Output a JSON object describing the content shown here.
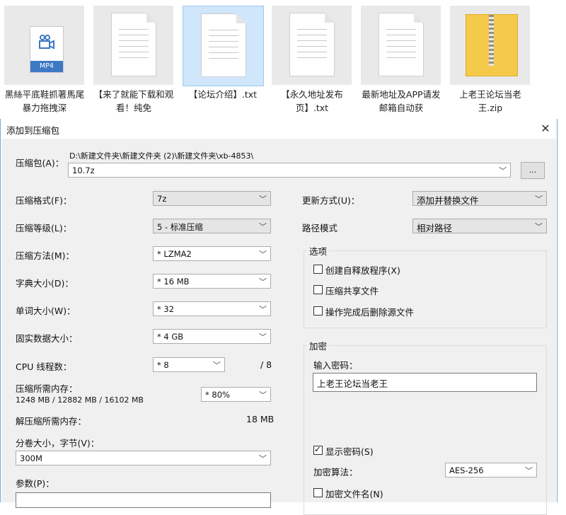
{
  "files": [
    {
      "name": "黑絲平底鞋抓著馬尾暴力拖拽深",
      "type": "MP4",
      "selected": false
    },
    {
      "name": "【来了就能下载和观看！纯免",
      "type": "txt",
      "selected": false
    },
    {
      "name": "【论坛介绍】.txt",
      "type": "txt",
      "selected": true
    },
    {
      "name": "【永久地址发布页】.txt",
      "type": "txt",
      "selected": false
    },
    {
      "name": "最新地址及APP请发邮箱自动获",
      "type": "txt",
      "selected": false
    },
    {
      "name": "上老王论坛当老王.zip",
      "type": "zip",
      "selected": false
    }
  ],
  "mp4_badge": "MP4",
  "dialog": {
    "title": "添加到压缩包",
    "close": "✕",
    "archive_label": "压缩包(A)：",
    "archive_path": "D:\\新建文件夹\\新建文件夹 (2)\\新建文件夹\\xb-4853\\",
    "archive_name": "10.7z",
    "browse": "...",
    "format_label": "压缩格式(F)：",
    "format": "7z",
    "level_label": "压缩等级(L)：",
    "level": "5 - 标准压缩",
    "method_label": "压缩方法(M)：",
    "method": "* LZMA2",
    "dict_label": "字典大小(D)：",
    "dict": "* 16 MB",
    "word_label": "单词大小(W)：",
    "word": "* 32",
    "solid_label": "固实数据大小：",
    "solid": "* 4 GB",
    "threads_label": "CPU 线程数：",
    "threads": "* 8",
    "threads_max": "/ 8",
    "mem_label": "压缩所需内存：",
    "mem_detail": "1248 MB / 12882 MB / 16102 MB",
    "mem_pct": "* 80%",
    "decomp_label": "解压缩所需内存：",
    "decomp_value": "18 MB",
    "volume_label": "分卷大小，字节(V)：",
    "volume": "300M",
    "params_label": "参数(P)：",
    "update_label": "更新方式(U)：",
    "update": "添加并替换文件",
    "pathmode_label": "路径模式",
    "pathmode": "相对路径",
    "options_title": "选项",
    "opt_sfx": "创建自释放程序(X)",
    "opt_shared": "压缩共享文件",
    "opt_delete": "操作完成后删除源文件",
    "encrypt_title": "加密",
    "password_label": "输入密码：",
    "password": "上老王论坛当老王",
    "show_password": "显示密码(S)",
    "enc_method_label": "加密算法：",
    "enc_method": "AES-256",
    "encrypt_names": "加密文件名(N)"
  }
}
